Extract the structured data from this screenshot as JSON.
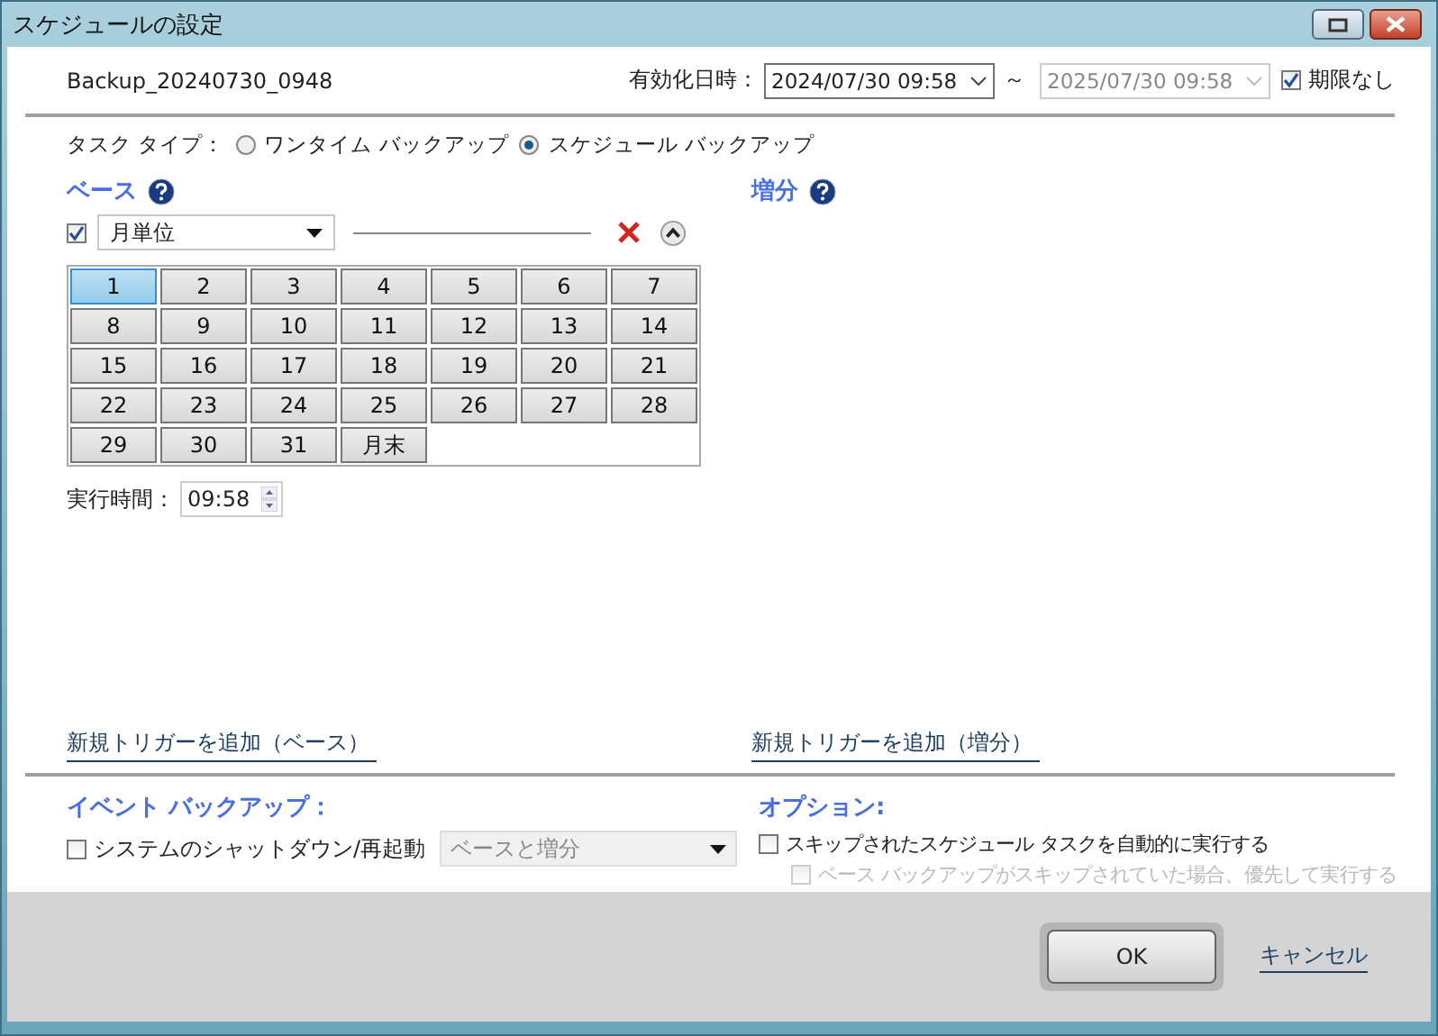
{
  "window": {
    "title": "スケジュールの設定"
  },
  "header": {
    "task_name": "Backup_20240730_0948",
    "validity_label": "有効化日時：",
    "start": {
      "value": "2024/07/30 09:58",
      "disabled": false
    },
    "separator": "～",
    "end": {
      "value": "2025/07/30 09:58",
      "disabled": true
    },
    "no_limit": {
      "label": "期限なし",
      "checked": true
    }
  },
  "task_type": {
    "label": "タスク タイプ：",
    "options": [
      {
        "label": "ワンタイム バックアップ",
        "selected": false
      },
      {
        "label": "スケジュール バックアップ",
        "selected": true
      }
    ]
  },
  "base": {
    "title": "ベース",
    "schedule": {
      "checked": true,
      "unit": "月単位"
    },
    "days": [
      {
        "label": "1",
        "selected": true
      },
      {
        "label": "2",
        "selected": false
      },
      {
        "label": "3",
        "selected": false
      },
      {
        "label": "4",
        "selected": false
      },
      {
        "label": "5",
        "selected": false
      },
      {
        "label": "6",
        "selected": false
      },
      {
        "label": "7",
        "selected": false
      },
      {
        "label": "8",
        "selected": false
      },
      {
        "label": "9",
        "selected": false
      },
      {
        "label": "10",
        "selected": false
      },
      {
        "label": "11",
        "selected": false
      },
      {
        "label": "12",
        "selected": false
      },
      {
        "label": "13",
        "selected": false
      },
      {
        "label": "14",
        "selected": false
      },
      {
        "label": "15",
        "selected": false
      },
      {
        "label": "16",
        "selected": false
      },
      {
        "label": "17",
        "selected": false
      },
      {
        "label": "18",
        "selected": false
      },
      {
        "label": "19",
        "selected": false
      },
      {
        "label": "20",
        "selected": false
      },
      {
        "label": "21",
        "selected": false
      },
      {
        "label": "22",
        "selected": false
      },
      {
        "label": "23",
        "selected": false
      },
      {
        "label": "24",
        "selected": false
      },
      {
        "label": "25",
        "selected": false
      },
      {
        "label": "26",
        "selected": false
      },
      {
        "label": "27",
        "selected": false
      },
      {
        "label": "28",
        "selected": false
      },
      {
        "label": "29",
        "selected": false
      },
      {
        "label": "30",
        "selected": false
      },
      {
        "label": "31",
        "selected": false
      },
      {
        "label": "月末",
        "selected": false
      }
    ],
    "time_label": "実行時間：",
    "time_value": "09:58",
    "add_trigger": "新規トリガーを追加（ベース）"
  },
  "incremental": {
    "title": "増分",
    "add_trigger": "新規トリガーを追加（増分）"
  },
  "event_backup": {
    "title": "イベント バックアップ：",
    "checkbox": {
      "label": "システムのシャットダウン/再起動",
      "checked": false
    },
    "dropdown": {
      "value": "ベースと増分",
      "disabled": true
    }
  },
  "options": {
    "title": "オプション:",
    "items": [
      {
        "label": "スキップされたスケジュール タスクを自動的に実行する",
        "checked": false,
        "disabled": false
      },
      {
        "label": "ベース バックアップがスキップされていた場合、優先して実行する",
        "checked": false,
        "disabled": true
      }
    ]
  },
  "footer": {
    "ok": "OK",
    "cancel": "キャンセル"
  }
}
